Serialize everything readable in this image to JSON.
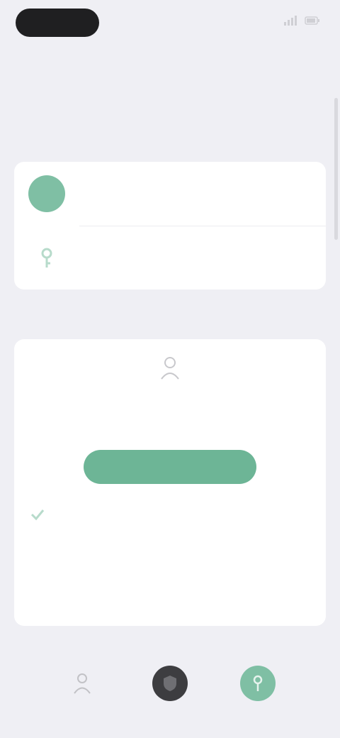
{
  "status_bar": {
    "time": "",
    "icons": [
      "signal-icon",
      "wifi-icon",
      "battery-icon"
    ]
  },
  "header": {
    "title": "",
    "subtitle": ""
  },
  "account": {
    "avatar_initials": "",
    "name": "",
    "detail": "",
    "key_row_label": ""
  },
  "section_one": {
    "label": ""
  },
  "main_card": {
    "heading": "",
    "description": "",
    "button_label": "",
    "info_title": "",
    "info_body": "",
    "info_link": ""
  },
  "section_two": {
    "label": "",
    "shortcuts": [
      {
        "label": "",
        "icon": "person-icon"
      },
      {
        "label": "",
        "icon": "shield-icon"
      },
      {
        "label": "",
        "icon": "key-icon"
      }
    ]
  },
  "colors": {
    "accent": "#6db596",
    "accent_light": "#7fbfa4",
    "background": "#efeff4",
    "card": "#ffffff"
  }
}
